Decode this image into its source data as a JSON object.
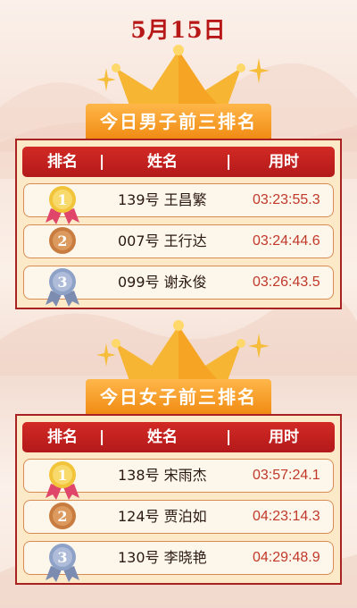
{
  "date": "5月15日",
  "sections": [
    {
      "title": "今日男子前三排名",
      "headers": {
        "rank": "排名",
        "sep": "|",
        "name": "姓名",
        "time": "用时"
      },
      "rows": [
        {
          "rank": "1",
          "bib": "139号",
          "name": "王昌繁",
          "time": "03:23:55.3"
        },
        {
          "rank": "2",
          "bib": "007号",
          "name": "王行达",
          "time": "03:24:44.6"
        },
        {
          "rank": "3",
          "bib": "099号",
          "name": "谢永俊",
          "time": "03:26:43.5"
        }
      ]
    },
    {
      "title": "今日女子前三排名",
      "headers": {
        "rank": "排名",
        "sep": "|",
        "name": "姓名",
        "time": "用时"
      },
      "rows": [
        {
          "rank": "1",
          "bib": "138号",
          "name": "宋雨杰",
          "time": "03:57:24.1"
        },
        {
          "rank": "2",
          "bib": "124号",
          "name": "贾泊如",
          "time": "04:23:14.3"
        },
        {
          "rank": "3",
          "bib": "130号",
          "name": "李晓艳",
          "time": "04:29:48.9"
        }
      ]
    }
  ],
  "colors": {
    "accent_red": "#b81717",
    "banner_orange": "#f08a12",
    "gold": "#f2c43a",
    "bronze": "#c97c3f",
    "silver": "#8ea2c8"
  },
  "icons": [
    "crown-icon",
    "sparkle-icon",
    "medal-gold-icon",
    "medal-bronze-icon",
    "medal-silver-icon"
  ]
}
